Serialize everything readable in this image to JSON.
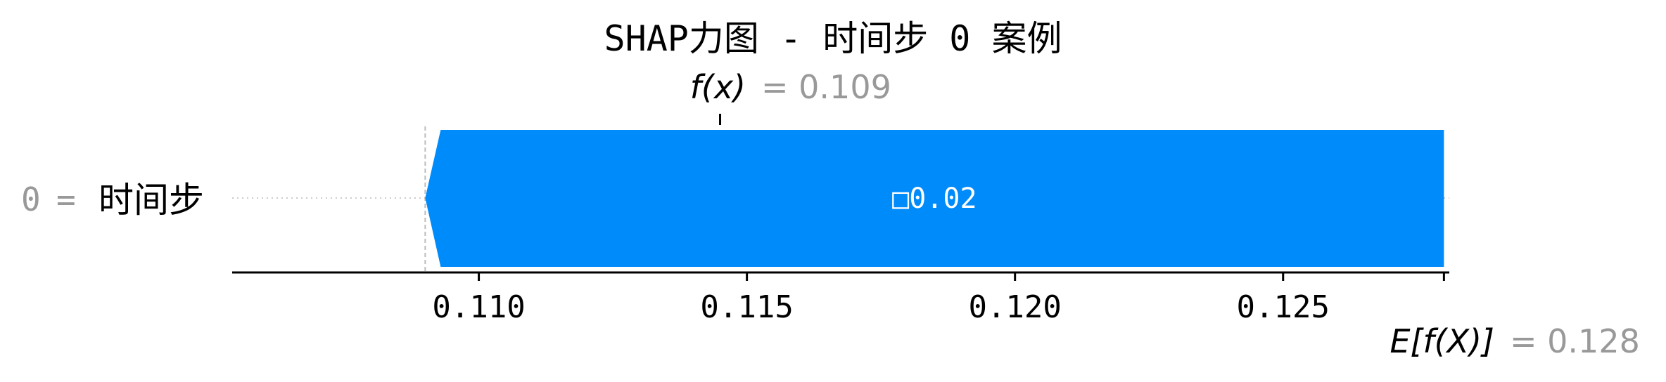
{
  "chart_data": {
    "type": "bar",
    "title": "SHAP力图 - 时间步 0 案例",
    "features": [
      {
        "name": "时间步",
        "value": "0",
        "shap": -0.02,
        "label": "□0.02"
      }
    ],
    "fx": 0.109,
    "fx_label": "f(x)",
    "fx_value_text": "= 0.109",
    "base_value": 0.128,
    "base_label": "E[f(X)]",
    "base_value_text": "= 0.128",
    "feature_label": {
      "value": "0",
      "eq": "=",
      "name": "时间步"
    },
    "xlim": [
      0.1054,
      0.1281
    ],
    "xticks": [
      0.11,
      0.115,
      0.12,
      0.125
    ],
    "xtick_labels": [
      "0.110",
      "0.115",
      "0.120",
      "0.125"
    ],
    "colors": {
      "negative": "#008bfb",
      "muted": "#999999",
      "axis": "#000000"
    }
  }
}
